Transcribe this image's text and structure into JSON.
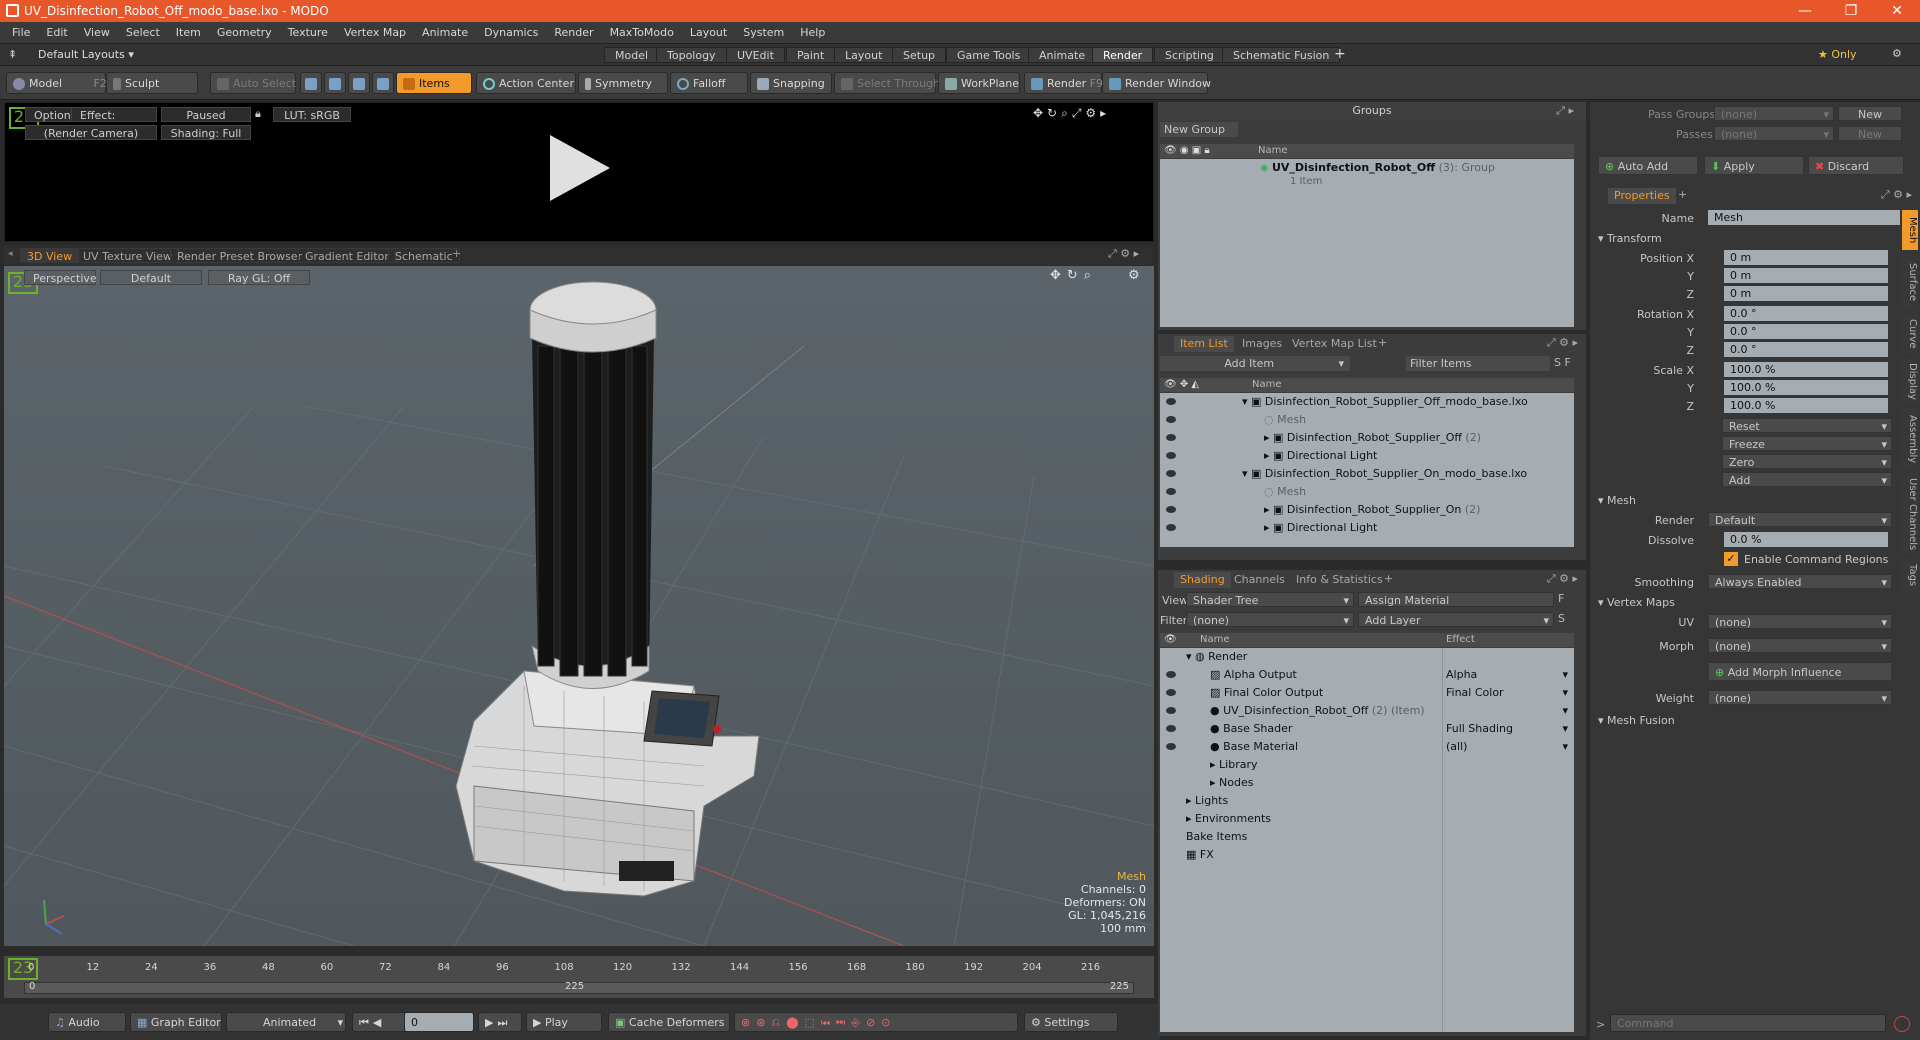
{
  "window": {
    "title": "UV_Disinfection_Robot_Off_modo_base.lxo - MODO",
    "minimize": "—",
    "maximize": "❐",
    "close": "✕"
  },
  "menu": [
    "File",
    "Edit",
    "View",
    "Select",
    "Item",
    "Geometry",
    "Texture",
    "Vertex Map",
    "Animate",
    "Dynamics",
    "Render",
    "MaxToModo",
    "Layout",
    "System",
    "Help"
  ],
  "layouts": {
    "current": "Default Layouts",
    "tabs": [
      "Model",
      "Topology",
      "UVEdit",
      "Paint",
      "Layout",
      "Setup",
      "Game Tools",
      "Animate",
      "Render",
      "Scripting",
      "Schematic Fusion"
    ],
    "active_tab": "Render",
    "add": "+",
    "only": "★ Only"
  },
  "toolbar": {
    "model": "Model",
    "model_key": "F2",
    "sculpt": "Sculpt",
    "auto_select": "Auto Select",
    "items": "Items",
    "action_center": "Action Center",
    "symmetry": "Symmetry",
    "falloff": "Falloff",
    "snapping": "Snapping",
    "select_through": "Select Through",
    "workplane": "WorkPlane",
    "render": "Render",
    "render_key": "F9",
    "render_window": "Render Window"
  },
  "render_view": {
    "options": "Options",
    "effect": "Effect: (Shadi...",
    "paused": "Paused",
    "lut": "LUT: sRGB",
    "camera": "(Render Camera)",
    "shading": "Shading: Full"
  },
  "viewport_tabs": [
    "3D View",
    "UV Texture View",
    "Render Preset Browser",
    "Gradient Editor",
    "Schematic"
  ],
  "viewport": {
    "perspective": "Perspective",
    "default": "Default",
    "raygl": "Ray GL: Off",
    "hud": {
      "label": "Mesh",
      "channels": "Channels: 0",
      "deformers": "Deformers: ON",
      "gl": "GL: 1,045,216",
      "unit": "100 mm"
    },
    "colors": {
      "bg_top": "#5b646a",
      "grid": "#6a747a",
      "x_axis": "#b05050",
      "y_axis": "#50a050"
    }
  },
  "timeline": {
    "ticks": [
      "0",
      "12",
      "24",
      "36",
      "48",
      "60",
      "72",
      "84",
      "96",
      "108",
      "120",
      "132",
      "144",
      "156",
      "168",
      "180",
      "192",
      "204",
      "216"
    ],
    "end": "225",
    "mid": "225"
  },
  "transport": {
    "audio": "Audio",
    "graph_editor": "Graph Editor",
    "animated": "Animated",
    "frame": "0",
    "play": "Play",
    "cache": "Cache Deformers",
    "settings": "Settings"
  },
  "groups": {
    "title": "Groups",
    "new_group": "New Group",
    "col_name": "Name",
    "item_name": "UV_Disinfection_Robot_Off",
    "item_count": "(3)",
    "item_type": ": Group",
    "item_sub": "1 Item"
  },
  "item_list": {
    "tabs": [
      "Item List",
      "Images",
      "Vertex Map List"
    ],
    "add_item": "Add Item",
    "filter": "Filter Items",
    "col_name": "Name",
    "rows": [
      {
        "label": "Disinfection_Robot_Supplier_Off_modo_base.lxo",
        "indent": 0,
        "dim": false
      },
      {
        "label": "Mesh",
        "indent": 1,
        "dim": true
      },
      {
        "label": "Disinfection_Robot_Supplier_Off",
        "extra": "(2)",
        "indent": 1,
        "dim": false
      },
      {
        "label": "Directional Light",
        "indent": 1,
        "dim": false
      },
      {
        "label": "Disinfection_Robot_Supplier_On_modo_base.lxo",
        "indent": 0,
        "dim": false
      },
      {
        "label": "Mesh",
        "indent": 1,
        "dim": true
      },
      {
        "label": "Disinfection_Robot_Supplier_On",
        "extra": "(2)",
        "indent": 1,
        "dim": false
      },
      {
        "label": "Directional Light",
        "indent": 1,
        "dim": false
      }
    ]
  },
  "shading": {
    "tabs": [
      "Shading",
      "Channels",
      "Info & Statistics"
    ],
    "view_label": "View",
    "view_value": "Shader Tree",
    "assign": "Assign Material",
    "filter_label": "Filter",
    "filter_value": "(none)",
    "add_layer": "Add Layer",
    "col_name": "Name",
    "col_effect": "Effect",
    "rows": [
      {
        "name": "Render",
        "effect": "",
        "indent": 0
      },
      {
        "name": "Alpha Output",
        "effect": "Alpha",
        "indent": 1
      },
      {
        "name": "Final Color Output",
        "effect": "Final Color",
        "indent": 1
      },
      {
        "name": "UV_Disinfection_Robot_Off",
        "extra": "(2) (Item)",
        "effect": "",
        "indent": 1
      },
      {
        "name": "Base Shader",
        "effect": "Full Shading",
        "indent": 1
      },
      {
        "name": "Base Material",
        "effect": "(all)",
        "indent": 1
      },
      {
        "name": "Library",
        "effect": "",
        "indent": 1
      },
      {
        "name": "Nodes",
        "effect": "",
        "indent": 1
      },
      {
        "name": "Lights",
        "effect": "",
        "indent": 0
      },
      {
        "name": "Environments",
        "effect": "",
        "indent": 0
      },
      {
        "name": "Bake Items",
        "effect": "",
        "indent": 0
      },
      {
        "name": "FX",
        "effect": "",
        "indent": 0
      }
    ]
  },
  "passes": {
    "pass_groups": "Pass Groups",
    "passes": "Passes",
    "none": "(none)",
    "new": "New",
    "auto_add": "Auto Add",
    "apply": "Apply",
    "discard": "Discard"
  },
  "properties": {
    "tab": "Properties",
    "name_label": "Name",
    "name_value": "Mesh",
    "transform": "Transform",
    "position_label": "Position X",
    "rotation_label": "Rotation X",
    "scale_label": "Scale X",
    "y": "Y",
    "z": "Z",
    "position": [
      "0 m",
      "0 m",
      "0 m"
    ],
    "rotation": [
      "0.0 °",
      "0.0 °",
      "0.0 °"
    ],
    "scale": [
      "100.0 %",
      "100.0 %",
      "100.0 %"
    ],
    "actions": [
      "Reset",
      "Freeze",
      "Zero",
      "Add"
    ],
    "mesh": "Mesh",
    "render_label": "Render",
    "render_value": "Default",
    "dissolve_label": "Dissolve",
    "dissolve_value": "0.0 %",
    "enable_cmd": "Enable Command Regions",
    "smoothing_label": "Smoothing",
    "smoothing_value": "Always Enabled",
    "vertex_maps": "Vertex Maps",
    "uv_label": "UV",
    "uv_value": "(none)",
    "morph_label": "Morph",
    "morph_value": "(none)",
    "add_morph": "Add Morph Influence",
    "weight_label": "Weight",
    "weight_value": "(none)",
    "mesh_fusion": "Mesh Fusion",
    "side_tabs": [
      "Mesh",
      "Surface",
      "Curve",
      "Display",
      "Assembly",
      "User Channels",
      "Tags"
    ]
  },
  "command": {
    "placeholder": "Command"
  }
}
